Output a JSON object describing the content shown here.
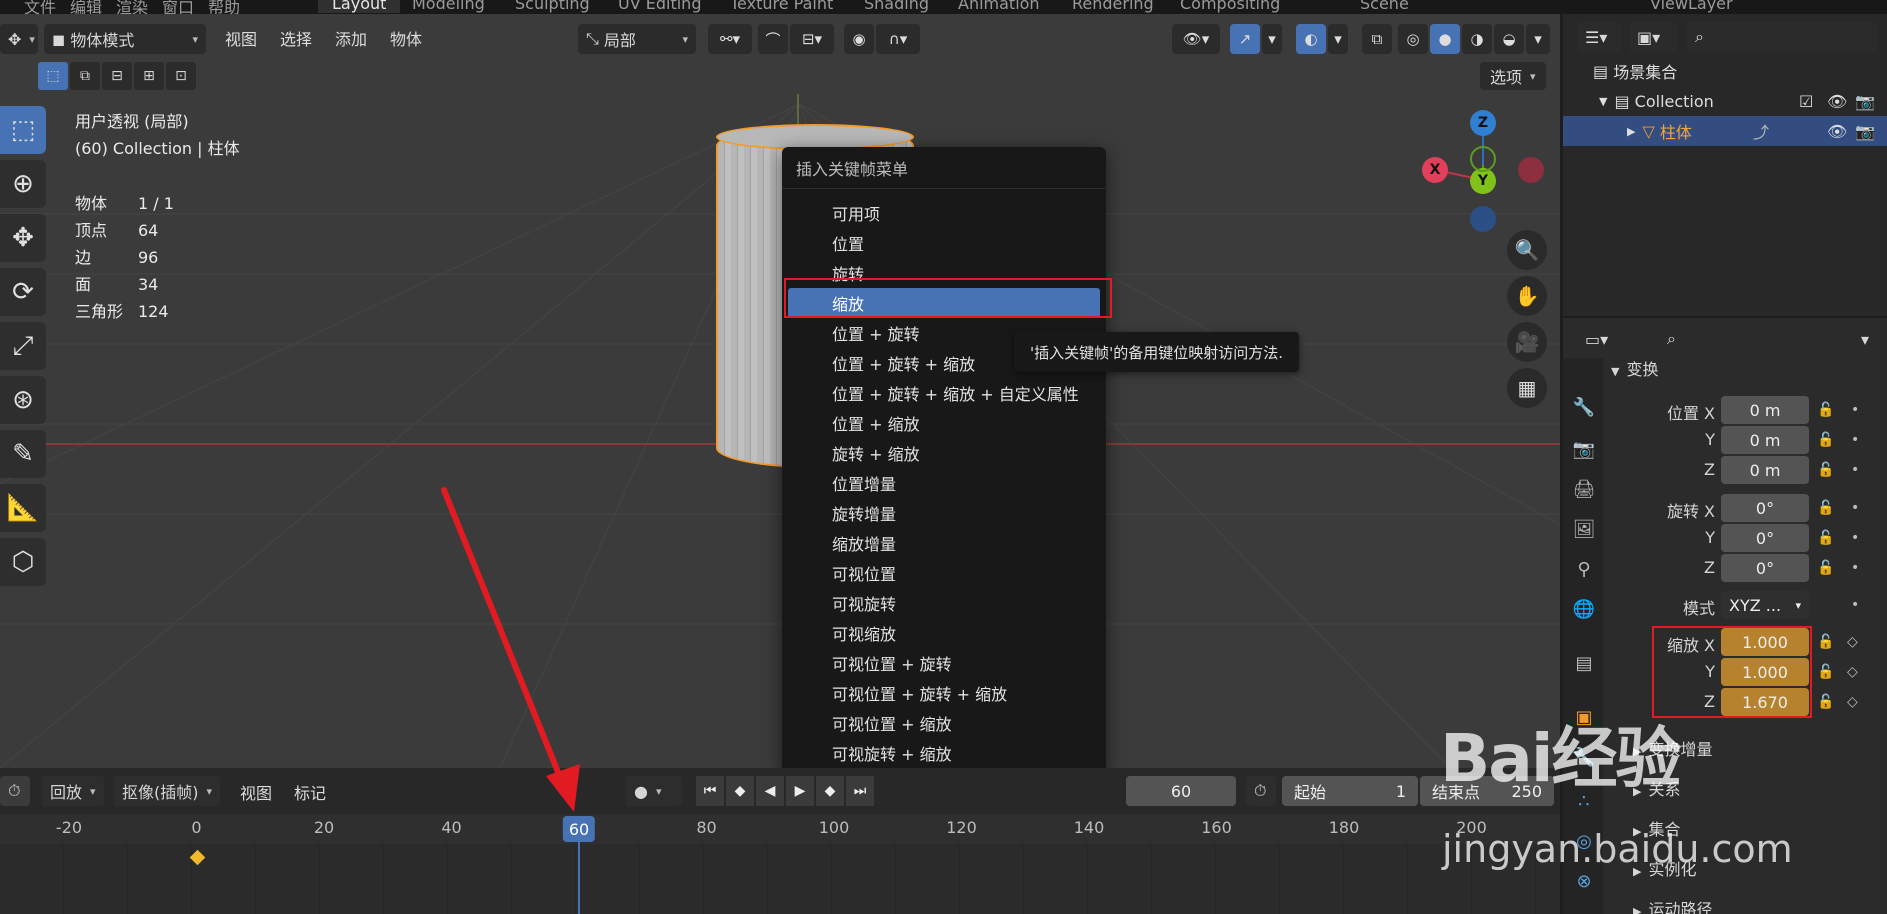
{
  "workspace": {
    "menus": [
      "文件",
      "编辑",
      "渲染",
      "窗口",
      "帮助"
    ],
    "tabs": [
      "Layout",
      "Modeling",
      "Sculpting",
      "UV Editing",
      "Texture Paint",
      "Shading",
      "Animation",
      "Rendering",
      "Compositing"
    ],
    "active_tab": "Layout",
    "scene": "Scene",
    "view_layer": "ViewLayer"
  },
  "viewport": {
    "mode": "物体模式",
    "menus": [
      "视图",
      "选择",
      "添加",
      "物体"
    ],
    "orientation": "局部",
    "options": "选项",
    "info_line1": "用户透视 (局部)",
    "info_line2": "(60) Collection | 柱体",
    "stats": [
      {
        "label": "物体",
        "value": "1 / 1"
      },
      {
        "label": "顶点",
        "value": "64"
      },
      {
        "label": "边",
        "value": "96"
      },
      {
        "label": "面",
        "value": "34"
      },
      {
        "label": "三角形",
        "value": "124"
      }
    ],
    "gizmo": {
      "x": "X",
      "y": "Y",
      "z": "Z"
    }
  },
  "context_menu": {
    "title": "插入关键帧菜单",
    "items": [
      "可用项",
      "位置",
      "旋转",
      "缩放",
      "位置 + 旋转",
      "位置 + 旋转 + 缩放",
      "位置 + 旋转 + 缩放 + 自定义属性",
      "位置 + 缩放",
      "旋转 + 缩放",
      "位置增量",
      "旋转增量",
      "缩放增量",
      "可视位置",
      "可视旋转",
      "可视缩放",
      "可视位置 + 旋转",
      "可视位置 + 旋转 + 缩放",
      "可视位置 + 缩放",
      "可视旋转 + 缩放"
    ],
    "highlighted": "缩放",
    "tooltip": "'插入关键帧'的备用键位映射访问方法."
  },
  "timeline": {
    "playback": "回放",
    "keying": "抠像(插帧)",
    "menus": [
      "视图",
      "标记"
    ],
    "current_frame": "60",
    "start_label": "起始",
    "start_value": "1",
    "end_label": "结束点",
    "end_value": "250",
    "ticks": [
      "-20",
      "0",
      "20",
      "40",
      "60",
      "80",
      "100",
      "120",
      "140",
      "160",
      "180",
      "200"
    ]
  },
  "outliner": {
    "root": "场景集合",
    "collection": "Collection",
    "object": "柱体"
  },
  "properties": {
    "section_transform": "变换",
    "location_label": "位置 X",
    "location": [
      "0 m",
      "0 m",
      "0 m"
    ],
    "rotation_label": "旋转 X",
    "rotation": [
      "0°",
      "0°",
      "0°"
    ],
    "mode_label": "模式",
    "mode_value": "XYZ ...",
    "scale_label": "缩放 X",
    "scale": [
      "1.000",
      "1.000",
      "1.670"
    ],
    "axis_y": "Y",
    "axis_z": "Z",
    "sections": [
      "变换增量",
      "关系",
      "集合",
      "实例化",
      "运动路径"
    ]
  },
  "watermark": {
    "logo": "Bai经验",
    "url": "jingyan.baidu.com"
  }
}
